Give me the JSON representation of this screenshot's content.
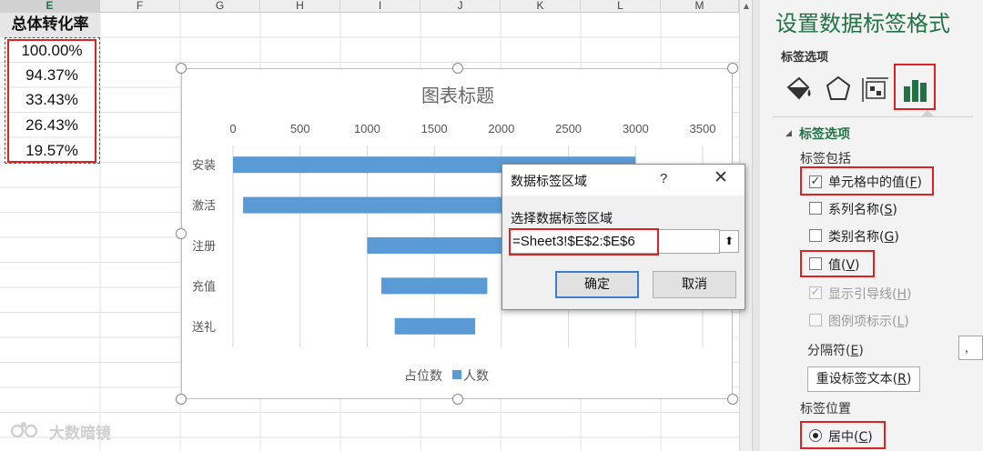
{
  "sheet": {
    "columns": [
      "E",
      "F",
      "G",
      "H",
      "I",
      "J",
      "K",
      "L",
      "M"
    ],
    "selected_column": "E",
    "header_cell": "总体转化率",
    "values": [
      "100.00%",
      "94.37%",
      "33.43%",
      "26.43%",
      "19.57%"
    ]
  },
  "chart_data": {
    "type": "bar",
    "subtype": "stacked-horizontal-funnel",
    "title": "图表标题",
    "categories": [
      "安装",
      "激活",
      "注册",
      "充值",
      "送礼"
    ],
    "series": [
      {
        "name": "占位数",
        "values": [
          0,
          75,
          1000,
          1105,
          1205
        ],
        "visible": false
      },
      {
        "name": "人数",
        "values": [
          3000,
          2850,
          1000,
          790,
          600
        ],
        "color": "#5b9bd5"
      }
    ],
    "xlim": [
      0,
      3500
    ],
    "xticks": [
      0,
      500,
      1000,
      1500,
      2000,
      2500,
      3000,
      3500
    ],
    "xtick_labels": [
      "0",
      "500",
      "1000",
      "1500",
      "2000",
      "2500",
      "3000",
      "3500"
    ],
    "axis_position": "top",
    "grid": "vertical",
    "legend_position": "bottom"
  },
  "dialog": {
    "title": "数据标签区域",
    "help": "?",
    "close": "✕",
    "label": "选择数据标签区域",
    "range_value": "=Sheet3!$E$2:$E$6",
    "collapse": "⬆",
    "ok": "确定",
    "cancel": "取消"
  },
  "pane": {
    "title": "设置数据标签格式",
    "subtitle": "标签选项",
    "section_arrow": "◢",
    "section": "标签选项",
    "contains_label": "标签包括",
    "options": [
      {
        "prefix": "单元格中的值(",
        "key": "F",
        "suffix": ")",
        "checked": true,
        "enabled": true
      },
      {
        "prefix": "系列名称(",
        "key": "S",
        "suffix": ")",
        "checked": false,
        "enabled": true
      },
      {
        "prefix": "类别名称(",
        "key": "G",
        "suffix": ")",
        "checked": false,
        "enabled": true
      },
      {
        "prefix": "值(",
        "key": "V",
        "suffix": ")",
        "checked": false,
        "enabled": true
      },
      {
        "prefix": "显示引导线(",
        "key": "H",
        "suffix": ")",
        "checked": true,
        "enabled": false
      },
      {
        "prefix": "图例项标示(",
        "key": "L",
        "suffix": ")",
        "checked": false,
        "enabled": false
      }
    ],
    "separator_prefix": "分隔符(",
    "separator_key": "E",
    "separator_suffix": ")",
    "separator_value": ",",
    "reset_prefix": "重设标签文本(",
    "reset_key": "R",
    "reset_suffix": ")",
    "position_label": "标签位置",
    "position_prefix": "居中(",
    "position_key": "C",
    "position_suffix": ")",
    "check_mark": "✓"
  },
  "watermark": {
    "text": "大数暗镜"
  },
  "colors": {
    "accent": "#217346",
    "bar": "#5b9bd5",
    "highlight": "#dd2222"
  }
}
